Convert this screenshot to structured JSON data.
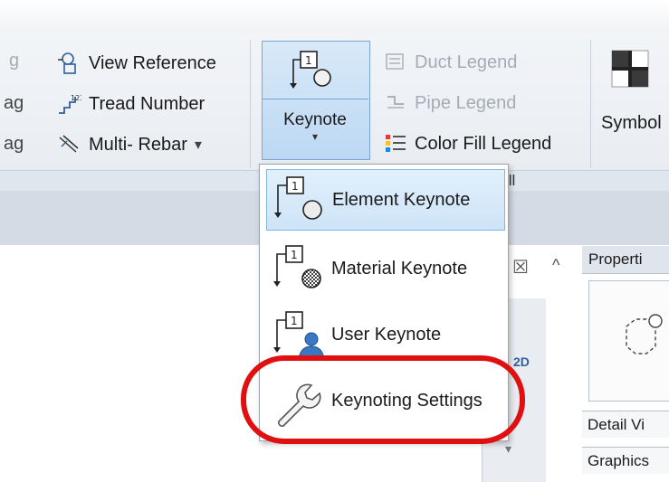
{
  "ribbon": {
    "col1": {
      "item1": "g",
      "item2": "ag",
      "item3": "ag"
    },
    "col2": {
      "view_reference": "View Reference",
      "tread_number": "Tread Number",
      "multi_rebar": "Multi- Rebar",
      "dropdown_arrow": "▾"
    },
    "keynote": {
      "label": "Keynote",
      "arrow": "▾"
    },
    "legends": {
      "duct": "Duct Legend",
      "pipe": "Pipe Legend",
      "color_fill": "Color Fill Legend"
    },
    "symbol": "Symbol",
    "panel_label_fragment": "ill"
  },
  "keynote_menu": {
    "items": [
      {
        "label": "Element Keynote",
        "icon": "element-keynote-icon"
      },
      {
        "label": "Material Keynote",
        "icon": "material-keynote-icon"
      },
      {
        "label": "User Keynote",
        "icon": "user-keynote-icon"
      },
      {
        "label": "Keynoting Settings",
        "icon": "wrench-icon"
      }
    ]
  },
  "properties": {
    "header": "Properti",
    "row1": "Detail Vi",
    "row2": "Graphics"
  },
  "mid_panel": {
    "label_2d": "2D",
    "close": "☒",
    "up": "^",
    "down": "▾"
  },
  "colors": {
    "highlight": "#e01010",
    "selection": "#cde4f8"
  }
}
